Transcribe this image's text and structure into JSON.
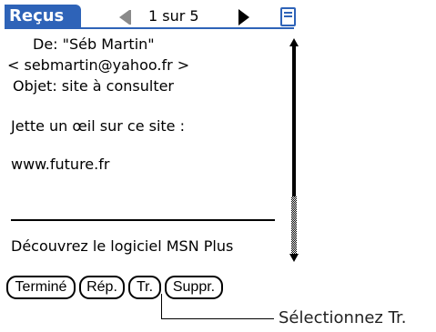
{
  "header": {
    "title": "Reçus",
    "page_indicator": "1 sur 5"
  },
  "message": {
    "from_line": "De: \"Séb Martin\"",
    "email_line": "< sebmartin@yahoo.fr >",
    "subject_line": "Objet: site à consulter",
    "body_line_1": "Jette un œil sur ce site :",
    "body_line_2": "www.future.fr",
    "signature": "Découvrez le logiciel MSN Plus"
  },
  "buttons": {
    "done": "Terminé",
    "reply": "Rép.",
    "forward": "Tr.",
    "delete": "Suppr."
  },
  "callout": {
    "text": "Sélectionnez Tr."
  },
  "colors": {
    "title_bar": "#2e63b8"
  },
  "icons": {
    "prev": "left-triangle-arrow",
    "next": "right-triangle-arrow",
    "menu": "menu-icon",
    "scroll_up": "up-arrow",
    "scroll_down": "down-arrow"
  }
}
